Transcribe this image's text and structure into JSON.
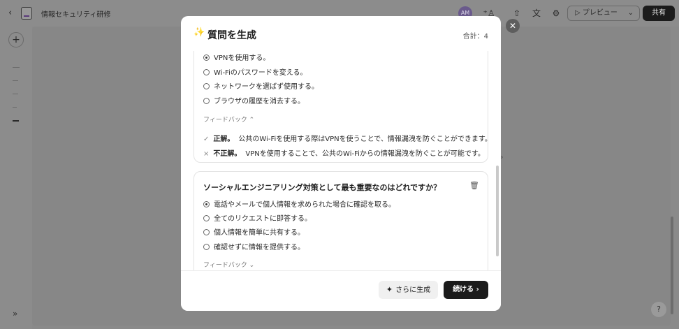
{
  "app": {
    "back_icon": "chevron-left-icon",
    "doc_title": "情報セキュリティ研修",
    "avatar_initials": "AM",
    "preview_label": "▷ プレビュー",
    "preview_chevron": "⌄",
    "share_label": "共有",
    "plus_label": "+",
    "expand_label": "»",
    "help_label": "?",
    "bg_dot": "。"
  },
  "modal": {
    "spark_icon": "✨",
    "title": "質問を生成",
    "total": "合計：4",
    "close_label": "✕",
    "questions": [
      {
        "options": [
          {
            "label": "VPNを使用する。",
            "selected": true
          },
          {
            "label": "Wi-Fiのパスワードを変える。",
            "selected": false
          },
          {
            "label": "ネットワークを選ばず使用する。",
            "selected": false
          },
          {
            "label": "ブラウザの履歴を消去する。",
            "selected": false
          }
        ],
        "feedback_label": "フィードバック ⌃",
        "feedback": [
          {
            "mark": "✓",
            "head": "正解。",
            "text": "公共のWi-Fiを使用する際はVPNを使うことで、情報漏洩を防ぐことができます。"
          },
          {
            "mark": "×",
            "head": "不正解。",
            "text": "VPNを使用することで、公共のWi-Fiからの情報漏洩を防ぐことが可能です。"
          }
        ]
      },
      {
        "question": "ソーシャルエンジニアリング対策として最も重要なのはどれですか？",
        "options": [
          {
            "label": "電話やメールで個人情報を求められた場合に確認を取る。",
            "selected": true
          },
          {
            "label": "全てのリクエストに即答する。",
            "selected": false
          },
          {
            "label": "個人情報を簡単に共有する。",
            "selected": false
          },
          {
            "label": "確認せずに情報を提供する。",
            "selected": false
          }
        ],
        "feedback_label": "フィードバック ⌄"
      }
    ],
    "generate_more": "さらに生成",
    "continue": "続ける ›"
  }
}
